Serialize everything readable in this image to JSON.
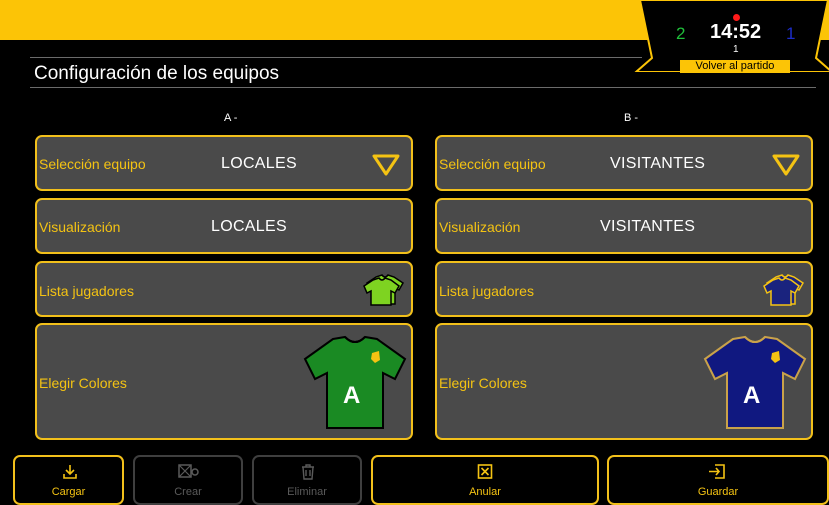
{
  "header": {
    "title": "Configuración de los equipos",
    "score_a": "2",
    "score_b": "1",
    "clock": "14:52",
    "period": "1",
    "back_label": "Volver al partido"
  },
  "columns": [
    {
      "heading": "A -",
      "team_select_label": "Selección equipo",
      "team_select_value": "LOCALES",
      "display_label": "Visualización",
      "display_value": "LOCALES",
      "players_label": "Lista jugadores",
      "colors_label": "Elegir Colores",
      "jersey_letter": "A",
      "jersey_color": "#1a8a23",
      "jersey_icon_color": "#7ed321"
    },
    {
      "heading": "B -",
      "team_select_label": "Selección equipo",
      "team_select_value": "VISITANTES",
      "display_label": "Visualización",
      "display_value": "VISITANTES",
      "players_label": "Lista jugadores",
      "colors_label": "Elegir Colores",
      "jersey_letter": "A",
      "jersey_color": "#101880",
      "jersey_icon_color": "#1a237e"
    }
  ],
  "toolbar": {
    "load": "Cargar",
    "create": "Crear",
    "delete": "Eliminar",
    "cancel": "Anular",
    "save": "Guardar"
  },
  "colors": {
    "accent": "#fcc406",
    "card_bg": "#4a4a4a",
    "label": "#f4c313"
  }
}
